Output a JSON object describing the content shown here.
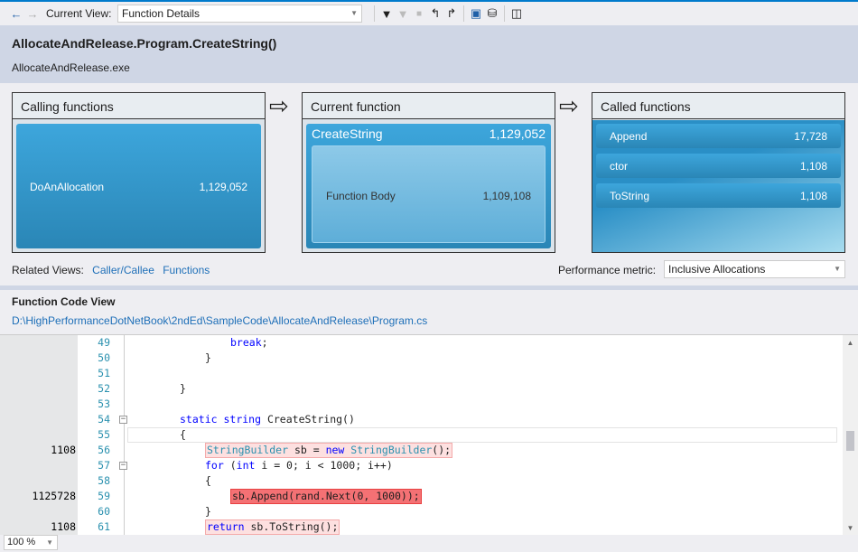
{
  "toolbar": {
    "current_view_label": "Current View:",
    "current_view": "Function Details"
  },
  "header": {
    "title": "AllocateAndRelease.Program.CreateString()",
    "module": "AllocateAndRelease.exe"
  },
  "calling": {
    "title": "Calling functions",
    "items": [
      {
        "name": "DoAnAllocation",
        "value": "1,129,052"
      }
    ]
  },
  "current": {
    "title": "Current function",
    "name": "CreateString",
    "value": "1,129,052",
    "body_label": "Function Body",
    "body_value": "1,109,108"
  },
  "called": {
    "title": "Called functions",
    "items": [
      {
        "name": "Append",
        "value": "17,728"
      },
      {
        "name": "ctor",
        "value": "1,108"
      },
      {
        "name": "ToString",
        "value": "1,108"
      }
    ]
  },
  "related": {
    "label": "Related Views:",
    "links": [
      "Caller/Callee",
      "Functions"
    ]
  },
  "metric": {
    "label": "Performance metric:",
    "value": "Inclusive Allocations"
  },
  "code_view": {
    "title": "Function Code View",
    "path": "D:\\HighPerformanceDotNetBook\\2ndEd\\SampleCode\\AllocateAndRelease\\Program.cs",
    "zoom": "100 %"
  },
  "colors": {
    "accent": "#007acc",
    "hot": "#f47174",
    "warm": "#fde0e0",
    "keyword": "#0000ff",
    "type": "#2b91af"
  },
  "code": [
    {
      "n": "49",
      "m": "",
      "ind": 4,
      "tok": [
        [
          "kw",
          "break"
        ],
        [
          "",
          "; "
        ]
      ]
    },
    {
      "n": "50",
      "m": "",
      "ind": 3,
      "tok": [
        [
          "",
          "}"
        ]
      ]
    },
    {
      "n": "51",
      "m": "",
      "ind": 0,
      "tok": []
    },
    {
      "n": "52",
      "m": "",
      "ind": 2,
      "tok": [
        [
          "",
          "}"
        ]
      ]
    },
    {
      "n": "53",
      "m": "",
      "ind": 0,
      "tok": []
    },
    {
      "n": "54",
      "m": "",
      "ind": 2,
      "fold": true,
      "tok": [
        [
          "kw",
          "static"
        ],
        [
          "",
          " "
        ],
        [
          "kw",
          "string"
        ],
        [
          "",
          " CreateString()"
        ]
      ]
    },
    {
      "n": "55",
      "m": "",
      "ind": 2,
      "cur": true,
      "tok": [
        [
          "",
          "{"
        ]
      ]
    },
    {
      "n": "56",
      "m": "1108",
      "ind": 3,
      "hl": "warm",
      "tok": [
        [
          "ty",
          "StringBuilder"
        ],
        [
          "",
          " sb = "
        ],
        [
          "kw",
          "new"
        ],
        [
          "",
          " "
        ],
        [
          "ty",
          "StringBuilder"
        ],
        [
          "",
          "();"
        ]
      ]
    },
    {
      "n": "57",
      "m": "",
      "ind": 3,
      "fold": true,
      "tok": [
        [
          "kw",
          "for"
        ],
        [
          "",
          " ("
        ],
        [
          "kw",
          "int"
        ],
        [
          "",
          " i = 0; i < 1000; i++)"
        ]
      ]
    },
    {
      "n": "58",
      "m": "",
      "ind": 3,
      "tok": [
        [
          "",
          "{"
        ]
      ]
    },
    {
      "n": "59",
      "m": "1125728",
      "ind": 4,
      "hl": "hot",
      "tok": [
        [
          "",
          "sb.Append(rand.Next(0, 1000));"
        ]
      ]
    },
    {
      "n": "60",
      "m": "",
      "ind": 3,
      "tok": [
        [
          "",
          "}"
        ]
      ]
    },
    {
      "n": "61",
      "m": "1108",
      "ind": 3,
      "hl": "warm",
      "tok": [
        [
          "kw",
          "return"
        ],
        [
          "",
          " sb.ToString();"
        ]
      ]
    }
  ]
}
